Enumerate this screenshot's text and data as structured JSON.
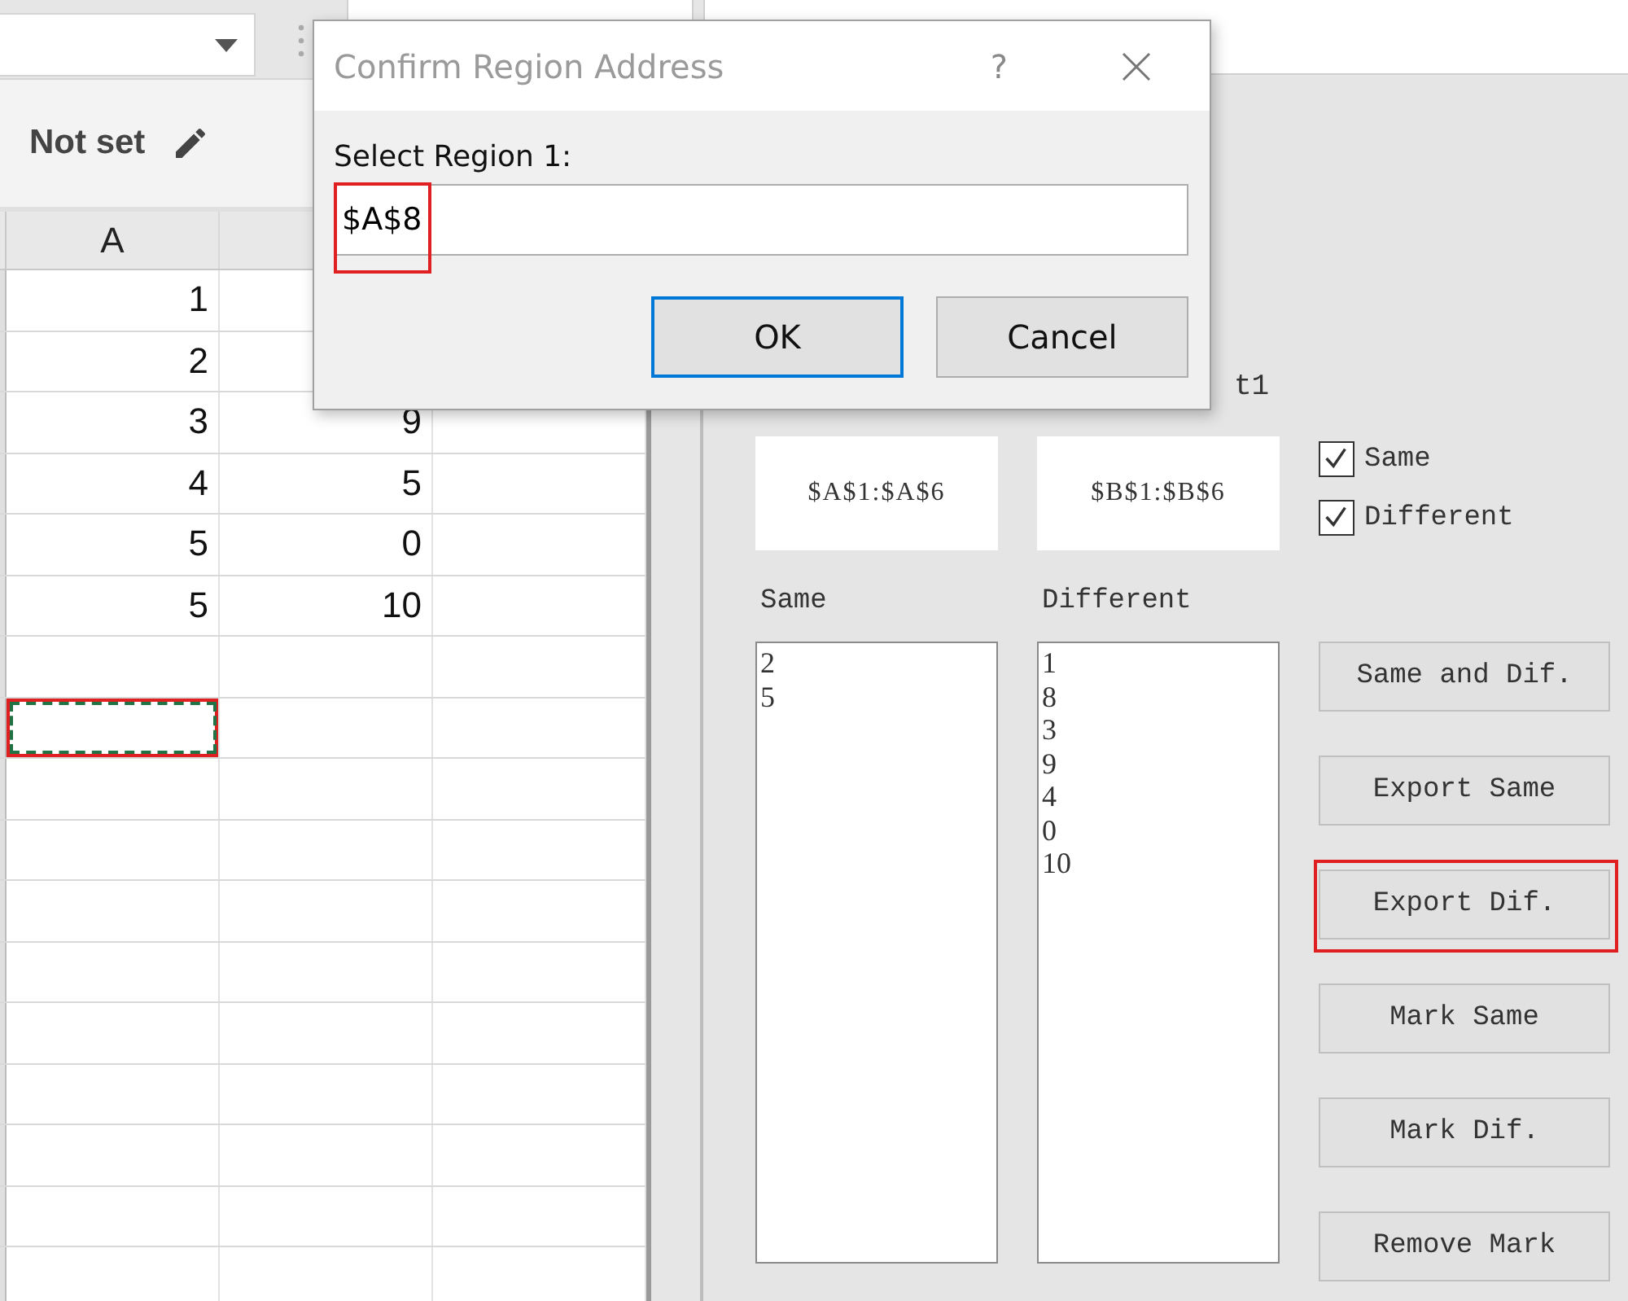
{
  "toolbar": {
    "name_box": {
      "dropdown": true
    }
  },
  "format_bar": {
    "label": "Not set"
  },
  "sheet": {
    "columns": [
      {
        "header": "A"
      }
    ],
    "rows": [
      {
        "cells": [
          "1"
        ]
      },
      {
        "cells": [
          "2"
        ]
      },
      {
        "cells": [
          "3",
          "9"
        ]
      },
      {
        "cells": [
          "4",
          "5"
        ]
      },
      {
        "cells": [
          "5",
          "0"
        ]
      },
      {
        "cells": [
          "5",
          "10"
        ]
      },
      {
        "kind": "blank"
      },
      {
        "kind": "blank",
        "marquee": true,
        "highlighted": true
      }
    ]
  },
  "panel": {
    "partial_label": "t1",
    "regions": [
      "$A$1:$A$6",
      "$B$1:$B$6"
    ],
    "checkboxes": [
      {
        "label": "Same",
        "checked": true
      },
      {
        "label": "Different",
        "checked": true
      }
    ],
    "lists": [
      {
        "title": "Same",
        "items": [
          "2",
          "5"
        ]
      },
      {
        "title": "Different",
        "items": [
          "1",
          "8",
          "3",
          "9",
          "4",
          "0",
          "10"
        ]
      }
    ],
    "buttons": [
      {
        "label": "Same and Dif.",
        "highlighted": false
      },
      {
        "label": "Export Same",
        "highlighted": false
      },
      {
        "label": "Export Dif.",
        "highlighted": true
      },
      {
        "label": "Mark Same",
        "highlighted": false
      },
      {
        "label": "Mark Dif.",
        "highlighted": false
      },
      {
        "label": "Remove Mark",
        "highlighted": false
      }
    ]
  },
  "dialog": {
    "title": "Confirm Region Address",
    "help": "?",
    "field_label": "Select Region 1:",
    "field_value": "$A$8",
    "value_highlighted": true,
    "buttons": [
      {
        "label": "OK",
        "default": true
      },
      {
        "label": "Cancel",
        "default": false
      }
    ]
  }
}
